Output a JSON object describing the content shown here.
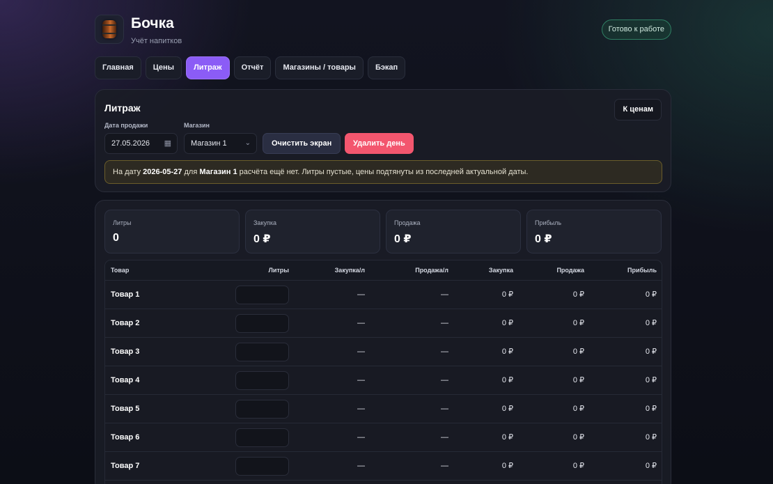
{
  "header": {
    "title": "Бочка",
    "subtitle": "Учёт напитков",
    "status": "Готово к работе",
    "logo_icon": "barrel-icon"
  },
  "nav": {
    "tabs": [
      {
        "label": "Главная",
        "active": false
      },
      {
        "label": "Цены",
        "active": false
      },
      {
        "label": "Литраж",
        "active": true
      },
      {
        "label": "Отчёт",
        "active": false
      },
      {
        "label": "Магазины / товары",
        "active": false
      },
      {
        "label": "Бэкап",
        "active": false
      }
    ]
  },
  "controls": {
    "section_title": "Литраж",
    "to_prices_label": "К ценам",
    "date_label": "Дата продажи",
    "date_value": "27.05.2026",
    "shop_label": "Магазин",
    "shop_value": "Магазин 1",
    "clear_label": "Очистить экран",
    "delete_label": "Удалить день"
  },
  "notice": {
    "prefix": "На дату ",
    "date": "2026-05-27",
    "mid": " для ",
    "shop": "Магазин 1",
    "suffix": " расчёта ещё нет. Литры пустые, цены подтянуты из последней актуальной даты."
  },
  "stats": [
    {
      "label": "Литры",
      "value": "0"
    },
    {
      "label": "Закупка",
      "value": "0 ₽"
    },
    {
      "label": "Продажа",
      "value": "0 ₽"
    },
    {
      "label": "Прибыль",
      "value": "0 ₽"
    }
  ],
  "table": {
    "headers": {
      "product": "Товар",
      "liters": "Литры",
      "buy_per_l": "Закупка/л",
      "sell_per_l": "Продажа/л",
      "buy": "Закупка",
      "sell": "Продажа",
      "profit": "Прибыль"
    },
    "rows": [
      {
        "name": "Товар 1",
        "buy_per_l": "—",
        "sell_per_l": "—",
        "buy": "0 ₽",
        "sell": "0 ₽",
        "profit": "0 ₽"
      },
      {
        "name": "Товар 2",
        "buy_per_l": "—",
        "sell_per_l": "—",
        "buy": "0 ₽",
        "sell": "0 ₽",
        "profit": "0 ₽"
      },
      {
        "name": "Товар 3",
        "buy_per_l": "—",
        "sell_per_l": "—",
        "buy": "0 ₽",
        "sell": "0 ₽",
        "profit": "0 ₽"
      },
      {
        "name": "Товар 4",
        "buy_per_l": "—",
        "sell_per_l": "—",
        "buy": "0 ₽",
        "sell": "0 ₽",
        "profit": "0 ₽"
      },
      {
        "name": "Товар 5",
        "buy_per_l": "—",
        "sell_per_l": "—",
        "buy": "0 ₽",
        "sell": "0 ₽",
        "profit": "0 ₽"
      },
      {
        "name": "Товар 6",
        "buy_per_l": "—",
        "sell_per_l": "—",
        "buy": "0 ₽",
        "sell": "0 ₽",
        "profit": "0 ₽"
      },
      {
        "name": "Товар 7",
        "buy_per_l": "—",
        "sell_per_l": "—",
        "buy": "0 ₽",
        "sell": "0 ₽",
        "profit": "0 ₽"
      }
    ]
  }
}
